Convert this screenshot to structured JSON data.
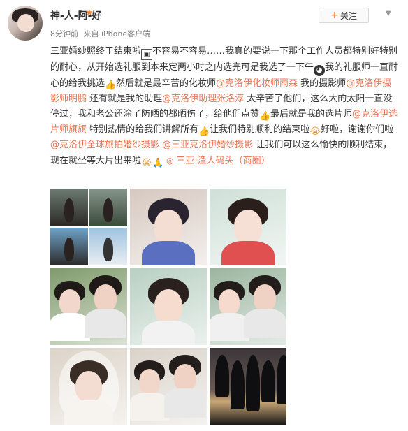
{
  "user": {
    "name": "神-人-阿-好",
    "vip_icon": "star-badge-icon"
  },
  "meta": {
    "time": "8分钟前",
    "source": "来自 iPhone客户端"
  },
  "follow_button": {
    "label": "关注"
  },
  "post": {
    "segments": [
      {
        "t": "text",
        "v": "三亚婚纱照终于结束啦"
      },
      {
        "t": "emoji",
        "v": "box",
        "icon": "box-emoji-icon"
      },
      {
        "t": "text",
        "v": "不容易不容易……我真的要说一下那个工作人员都特别好特别的耐心，从开始选礼服到本来定两小时之内选完可是我选了一下午"
      },
      {
        "t": "emoji",
        "v": "face",
        "icon": "weary-face-emoji-icon"
      },
      {
        "t": "text",
        "v": "我的礼服师一直耐心的给我挑选"
      },
      {
        "t": "emoji",
        "v": "thumb",
        "icon": "thumbs-up-emoji-icon"
      },
      {
        "t": "text",
        "v": "然后就是最辛苦的化妆师"
      },
      {
        "t": "link",
        "v": "@克洛伊化妆师雨森"
      },
      {
        "t": "text",
        "v": " 我的摄影师"
      },
      {
        "t": "link",
        "v": "@克洛伊摄影师明鹏"
      },
      {
        "t": "text",
        "v": " 还有就是我的助理"
      },
      {
        "t": "link",
        "v": "@克洛伊助理张洛淳"
      },
      {
        "t": "text",
        "v": " 太辛苦了他们，这么大的太阳一直没停过，我和老公还涂了防晒的都晒伤了，给他们点赞"
      },
      {
        "t": "emoji",
        "v": "thumb",
        "icon": "thumbs-up-emoji-icon"
      },
      {
        "t": "text",
        "v": "最后就是我的选片师"
      },
      {
        "t": "link",
        "v": "@克洛伊选片师旗旗"
      },
      {
        "t": "text",
        "v": " 特别热情的给我们讲解所有"
      },
      {
        "t": "emoji",
        "v": "thumb",
        "icon": "thumbs-up-emoji-icon"
      },
      {
        "t": "text",
        "v": "让我们特别顺利的结束啦"
      },
      {
        "t": "emoji",
        "v": "cry",
        "icon": "grimace-emoji-icon"
      },
      {
        "t": "text",
        "v": "好啦，谢谢你们啦"
      },
      {
        "t": "link",
        "v": "@克洛伊全球旅拍婚纱摄影"
      },
      {
        "t": "text",
        "v": " "
      },
      {
        "t": "link",
        "v": "@三亚克洛伊婚纱摄影"
      },
      {
        "t": "text",
        "v": " 让我们可以这么愉快的顺利结束，现在就坐等大片出来啦"
      },
      {
        "t": "emoji",
        "v": "cry",
        "icon": "tearful-face-emoji-icon"
      },
      {
        "t": "emoji",
        "v": "pray",
        "icon": "pray-hands-emoji-icon"
      },
      {
        "t": "text",
        "v": "  "
      },
      {
        "t": "loc",
        "v": "三亚·渔人码头（商圈）"
      }
    ]
  },
  "photos": [
    {
      "name": "photo-collage",
      "kind": "collage"
    },
    {
      "name": "photo-girl-blue-hair",
      "kind": "selfie",
      "bg": "#d6c8bf",
      "hair": "#2a2430",
      "face": "#f4ddd3",
      "accent": "#5a6fc0"
    },
    {
      "name": "photo-girl-headband",
      "kind": "selfie",
      "bg": "#cfe0d8",
      "hair": "#2b1f1c",
      "face": "#f6e0d6",
      "accent": "#e05050"
    },
    {
      "name": "photo-couple-sunglasses",
      "kind": "couple",
      "bg": "#7f9a6b",
      "hair": "#1f1a18",
      "face": "#f2d8cc",
      "accent": "#ffffff"
    },
    {
      "name": "photo-girl-cap",
      "kind": "selfie",
      "bg": "#b9d0c3",
      "hair": "#2a211e",
      "face": "#f6dccf",
      "accent": "#f2f2f2"
    },
    {
      "name": "photo-couple-peace-sign",
      "kind": "couple",
      "bg": "#9bb5a0",
      "hair": "#221c1a",
      "face": "#f5dacd",
      "accent": "#f0f0f0"
    },
    {
      "name": "photo-bride-veil",
      "kind": "bride",
      "bg": "#dcd3c8",
      "hair": "#3a2d26",
      "face": "#f3ddd2",
      "accent": "#f7f4ef"
    },
    {
      "name": "photo-bride-groom",
      "kind": "couple",
      "bg": "#d9d2c9",
      "hair": "#231d1b",
      "face": "#f1d6ca",
      "accent": "#f5f1ec"
    },
    {
      "name": "photo-palm-sunset",
      "kind": "sunset",
      "bg": "#2d2a2c",
      "hair": "#0f0e10",
      "face": "#caa877",
      "accent": "#1a1816"
    }
  ]
}
